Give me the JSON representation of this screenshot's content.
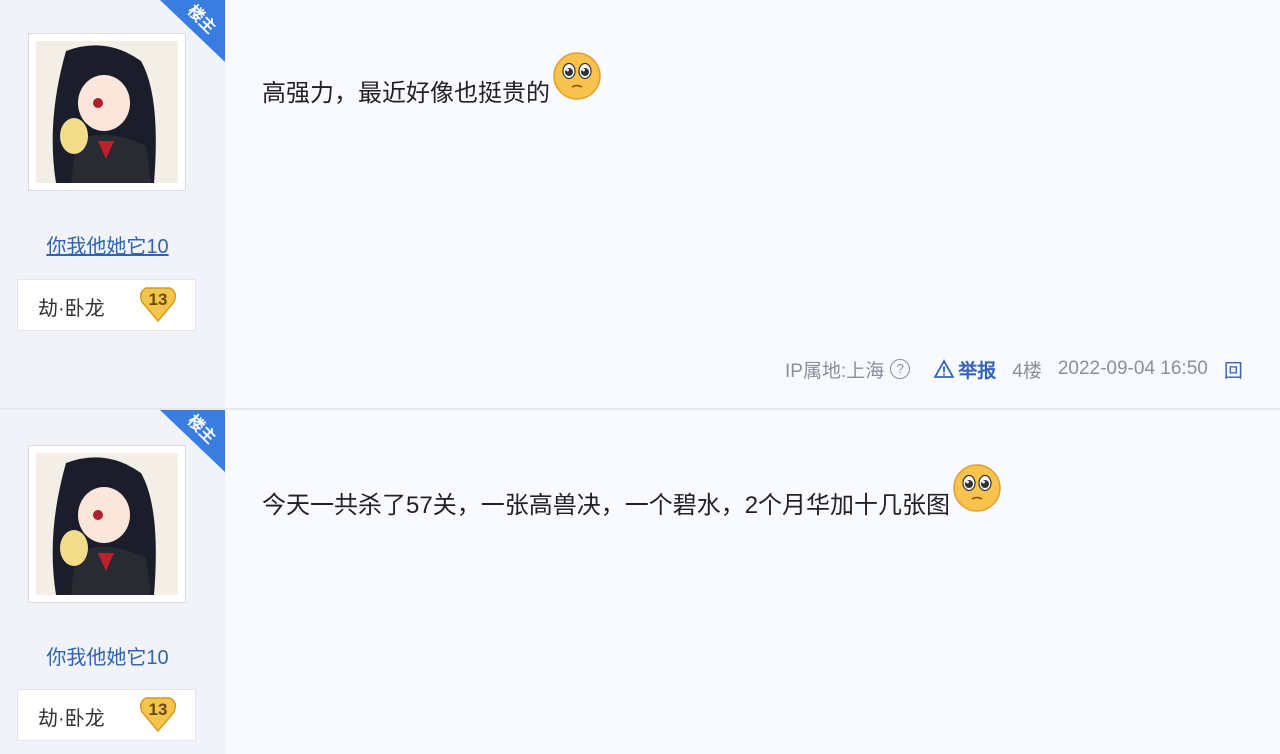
{
  "posts": [
    {
      "badge": "楼主",
      "username": "你我他她它10",
      "level_title": "劫·卧龙",
      "level": "13",
      "content": "高强力，最近好像也挺贵的",
      "ip_label": "IP属地:上海",
      "help_icon": "?",
      "report": "举报",
      "floor": "4楼",
      "time": "2022-09-04 16:50",
      "reply": "回"
    },
    {
      "badge": "楼主",
      "username": "你我他她它10",
      "level_title": "劫·卧龙",
      "level": "13",
      "content": "今天一共杀了57关，一张高兽决，一个碧水，2个月华加十几张图"
    }
  ],
  "icons": {
    "emoji": "pleading-face-icon",
    "warning": "warning-icon",
    "level_badge": "heart-badge-icon"
  },
  "colors": {
    "link": "#2d64b3",
    "badge": "#3a7de0",
    "level": "#f2c24a"
  }
}
